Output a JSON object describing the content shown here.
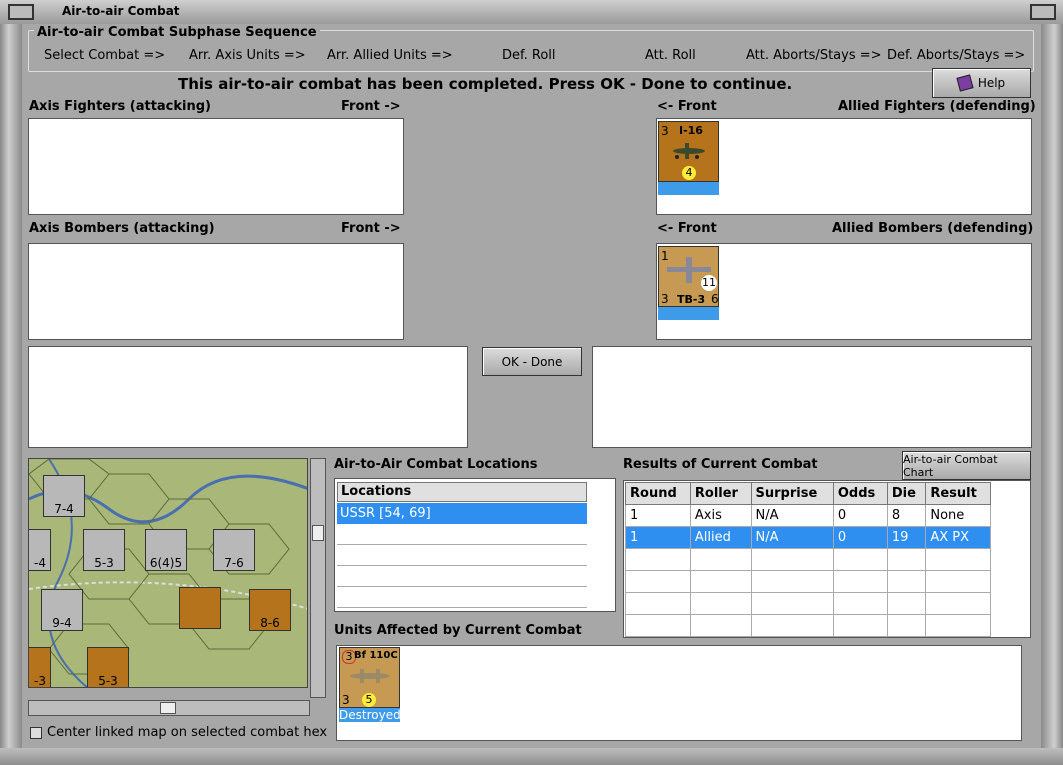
{
  "window": {
    "title": "Air-to-air Combat"
  },
  "sequence": {
    "title": "Air-to-air Combat Subphase Sequence",
    "steps": [
      "Select Combat =>",
      "Arr. Axis Units =>",
      "Arr. Allied Units =>",
      "Def. Roll",
      "Att. Roll",
      "Att. Aborts/Stays =>",
      "Def. Aborts/Stays =>"
    ]
  },
  "status_message": "This air-to-air combat has been completed.  Press OK - Done to continue.",
  "help_label": "Help",
  "panels": {
    "axis_fighters": {
      "label": "Axis Fighters (attacking)",
      "front": "Front ->"
    },
    "allied_fighters": {
      "label": "Allied Fighters (defending)",
      "front": "<- Front"
    },
    "axis_bombers": {
      "label": "Axis Bombers (attacking)",
      "front": "Front ->"
    },
    "allied_bombers": {
      "label": "Allied Bombers (defending)",
      "front": "<- Front"
    }
  },
  "counters": {
    "i16": {
      "name": "I-16",
      "top_left": "3",
      "bottom": "4"
    },
    "tb3": {
      "name": "TB-3",
      "top_left": "1",
      "bottom_left": "3",
      "circle": "11",
      "bottom_right": "6"
    },
    "bf110": {
      "name": "Bf 110C",
      "top_left": "3",
      "bottom_left": "3",
      "circle": "5",
      "status": "Destroyed"
    }
  },
  "ok_done_label": "OK - Done",
  "locations": {
    "title": "Air-to-Air Combat Locations",
    "header": "Locations",
    "rows": [
      "USSR [54, 69]"
    ]
  },
  "results": {
    "title": "Results of Current Combat",
    "chart_button": "Air-to-air Combat Chart",
    "columns": [
      "Round",
      "Roller",
      "Surprise",
      "Odds",
      "Die",
      "Result"
    ],
    "rows": [
      [
        "1",
        "Axis",
        "N/A",
        "0",
        "8",
        "None"
      ],
      [
        "1",
        "Allied",
        "N/A",
        "0",
        "19",
        "AX PX"
      ]
    ]
  },
  "affected": {
    "title": "Units Affected by Current Combat"
  },
  "map_units": [
    {
      "value": "7-4"
    },
    {
      "value": "5-3"
    },
    {
      "value": "6(4)5"
    },
    {
      "value": "7-6"
    },
    {
      "value": "9-4"
    },
    {
      "value": "8-6"
    },
    {
      "value": "5-3"
    },
    {
      "value": "-4"
    },
    {
      "value": "-3"
    }
  ],
  "center_checkbox_label": "Center linked map on selected combat hex",
  "colors": {
    "selection": "#2f8ff0",
    "counter_brown": "#b5731c",
    "frame": "#a7a7a7"
  }
}
